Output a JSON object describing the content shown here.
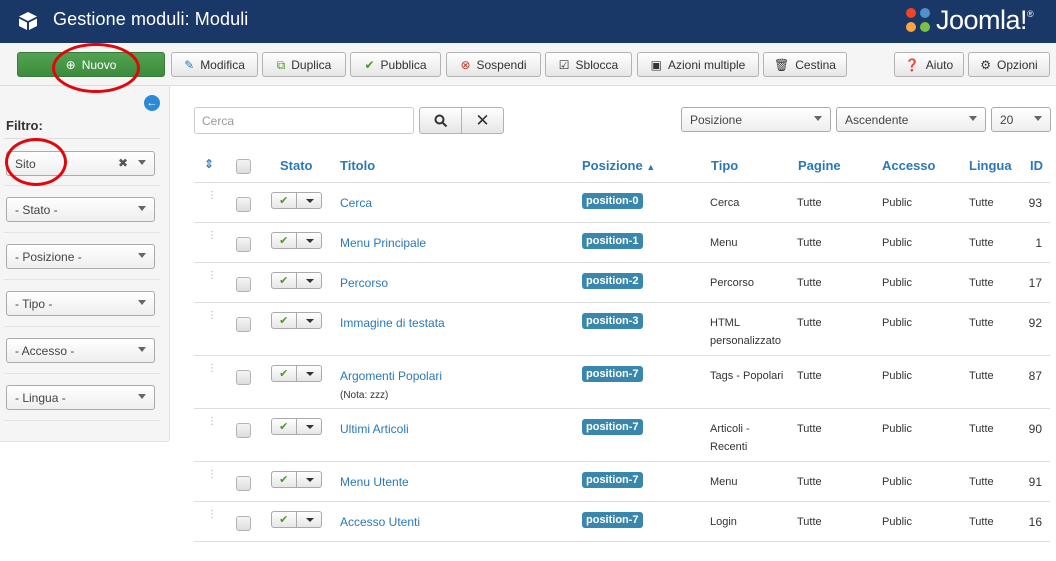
{
  "header": {
    "title": "Gestione moduli: Moduli",
    "logo_text": "Joomla!",
    "logo_sup": "®"
  },
  "toolbar": {
    "buttons": [
      {
        "label": "Nuovo",
        "icon": "plus-circle-icon"
      },
      {
        "label": "Modifica",
        "icon": "edit-icon"
      },
      {
        "label": "Duplica",
        "icon": "copy-icon"
      },
      {
        "label": "Pubblica",
        "icon": "check-icon"
      },
      {
        "label": "Sospendi",
        "icon": "x-circle-icon"
      },
      {
        "label": "Sblocca",
        "icon": "checkbox-icon"
      },
      {
        "label": "Azioni multiple",
        "icon": "square-icon"
      },
      {
        "label": "Cestina",
        "icon": "trash-icon"
      },
      {
        "label": "Aiuto",
        "icon": "question-circle-icon"
      },
      {
        "label": "Opzioni",
        "icon": "gear-icon"
      }
    ]
  },
  "sidebar": {
    "filter_label": "Filtro:",
    "filters": [
      "Sito",
      "- Stato -",
      "- Posizione -",
      "- Tipo -",
      "- Accesso -",
      "- Lingua -"
    ]
  },
  "search": {
    "placeholder": "Cerca",
    "sort_field": "Posizione",
    "sort_dir": "Ascendente",
    "limit": "20"
  },
  "table": {
    "headers": {
      "stato": "Stato",
      "titolo": "Titolo",
      "posizione": "Posizione",
      "tipo": "Tipo",
      "pagine": "Pagine",
      "accesso": "Accesso",
      "lingua": "Lingua",
      "id": "ID"
    },
    "rows": [
      {
        "title": "Cerca",
        "note": "",
        "position": "position-0",
        "type": [
          "Cerca"
        ],
        "pages": "Tutte",
        "access": "Public",
        "lang": "Tutte",
        "id": "93"
      },
      {
        "title": "Menu Principale",
        "note": "",
        "position": "position-1",
        "type": [
          "Menu"
        ],
        "pages": "Tutte",
        "access": "Public",
        "lang": "Tutte",
        "id": "1"
      },
      {
        "title": "Percorso",
        "note": "",
        "position": "position-2",
        "type": [
          "Percorso"
        ],
        "pages": "Tutte",
        "access": "Public",
        "lang": "Tutte",
        "id": "17"
      },
      {
        "title": "Immagine di testata",
        "note": "",
        "position": "position-3",
        "type": [
          "HTML",
          "personalizzato"
        ],
        "pages": "Tutte",
        "access": "Public",
        "lang": "Tutte",
        "id": "92"
      },
      {
        "title": "Argomenti Popolari",
        "note": "(Nota: zzz)",
        "position": "position-7",
        "type": [
          "Tags - Popolari"
        ],
        "pages": "Tutte",
        "access": "Public",
        "lang": "Tutte",
        "id": "87"
      },
      {
        "title": "Ultimi Articoli",
        "note": "",
        "position": "position-7",
        "type": [
          "Articoli -",
          "Recenti"
        ],
        "pages": "Tutte",
        "access": "Public",
        "lang": "Tutte",
        "id": "90"
      },
      {
        "title": "Menu Utente",
        "note": "",
        "position": "position-7",
        "type": [
          "Menu"
        ],
        "pages": "Tutte",
        "access": "Public",
        "lang": "Tutte",
        "id": "91"
      },
      {
        "title": "Accesso Utenti",
        "note": "",
        "position": "position-7",
        "type": [
          "Login"
        ],
        "pages": "Tutte",
        "access": "Public",
        "lang": "Tutte",
        "id": "16"
      }
    ]
  },
  "colors": {
    "header_bg": "#1a3867",
    "link": "#2a78b9",
    "badge": "#3a87ad",
    "new_button": "#46a046",
    "annotation": "#e0060b"
  }
}
